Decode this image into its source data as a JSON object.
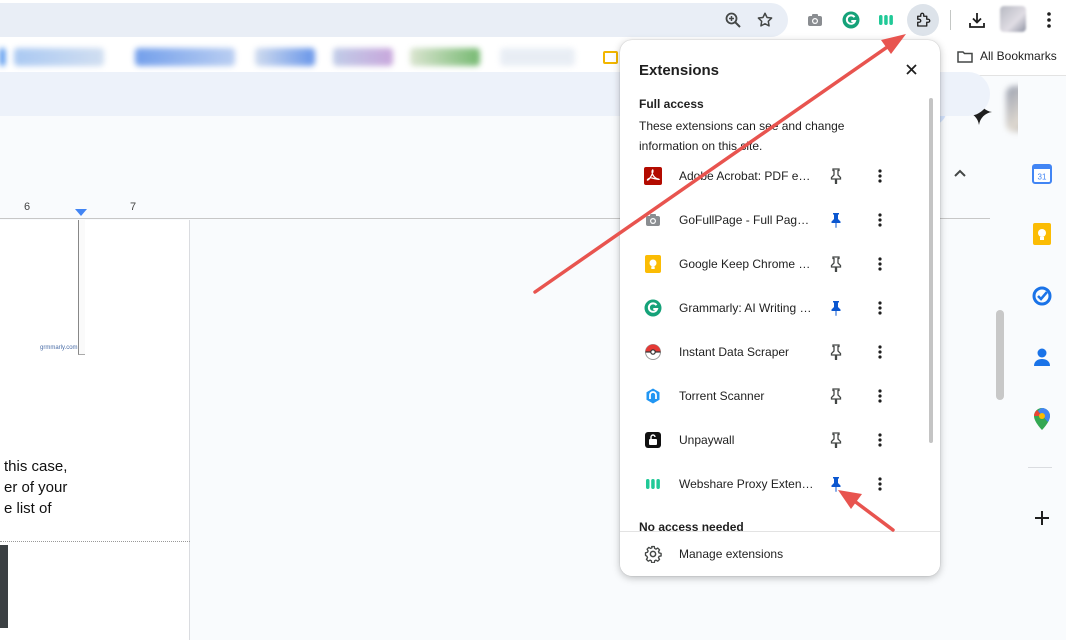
{
  "toolbar": {
    "icons": [
      "zoom-icon",
      "bookmark-star-icon",
      "camera-extension-icon",
      "grammarly-extension-icon",
      "webshare-extension-icon",
      "extensions-puzzle-icon",
      "download-icon",
      "profile-avatar",
      "more-menu-icon"
    ]
  },
  "bookmarks": {
    "all_bookmarks_label": "All Bookmarks"
  },
  "doc": {
    "ruler_marks": [
      "6",
      "7"
    ],
    "watermark": "grmmarly.com",
    "text_lines": [
      "this case,",
      "er of your",
      "e list of"
    ]
  },
  "popup": {
    "title": "Extensions",
    "full_access_title": "Full access",
    "full_access_desc": "These extensions can see and change information on this site.",
    "extensions": [
      {
        "name": "Adobe Acrobat: PDF edit, convert, sign tools",
        "icon": "adobe-acrobat-icon",
        "pinned": false
      },
      {
        "name": "GoFullPage - Full Page Screen Capture",
        "icon": "camera-icon",
        "pinned": true
      },
      {
        "name": "Google Keep Chrome Extension",
        "icon": "google-keep-icon",
        "pinned": false
      },
      {
        "name": "Grammarly: AI Writing and Grammar Checker App",
        "icon": "grammarly-icon",
        "pinned": true
      },
      {
        "name": "Instant Data Scraper",
        "icon": "pokeball-icon",
        "pinned": false
      },
      {
        "name": "Torrent Scanner",
        "icon": "torrent-scanner-icon",
        "pinned": false
      },
      {
        "name": "Unpaywall",
        "icon": "unlock-icon",
        "pinned": false
      },
      {
        "name": "Webshare Proxy Extension",
        "icon": "webshare-icon",
        "pinned": true
      }
    ],
    "no_access_title": "No access needed",
    "manage_label": "Manage extensions"
  },
  "colors": {
    "pin_active": "#0b57d0",
    "pin_inactive": "#444746",
    "arrow": "#e8544f"
  }
}
